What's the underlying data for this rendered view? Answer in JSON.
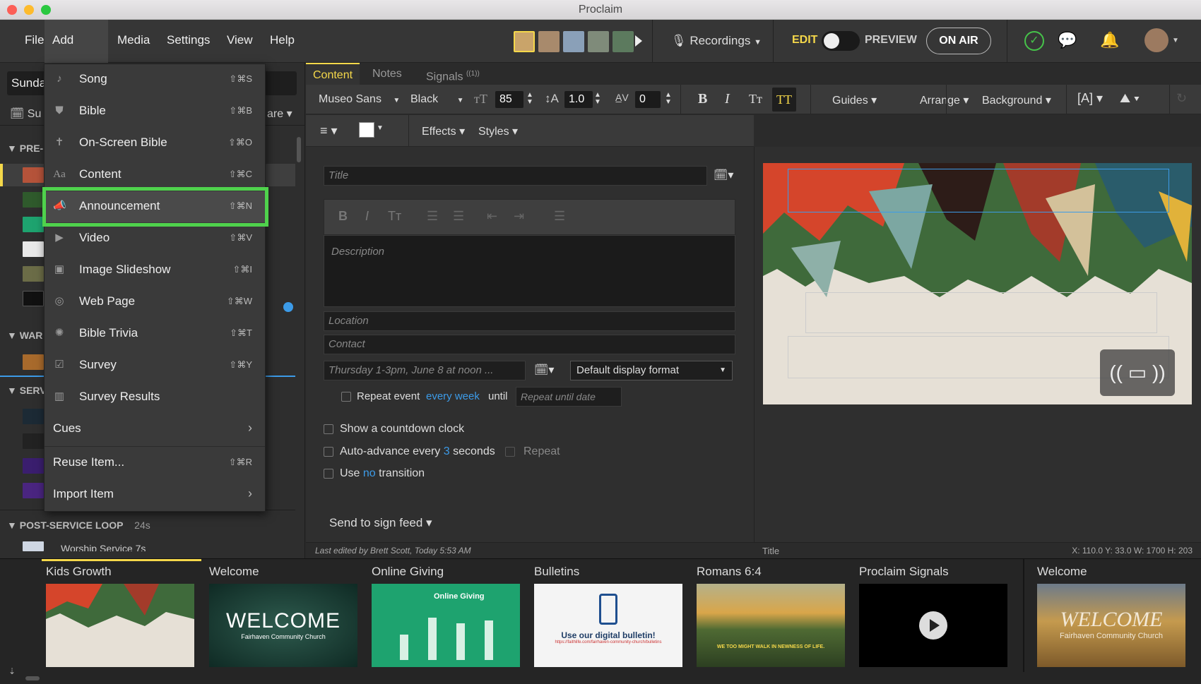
{
  "app": {
    "title": "Proclaim"
  },
  "menubar": {
    "items": [
      "File",
      "Add Item",
      "Media",
      "Settings",
      "View",
      "Help"
    ],
    "recordings": "Recordings",
    "edit": "EDIT",
    "preview": "PREVIEW",
    "on_air": "ON AIR"
  },
  "left": {
    "service_name": "Sunda",
    "date_label": "Su",
    "share_label": "are",
    "sections": [
      {
        "label": "PRE-"
      },
      {
        "label": "WAR"
      },
      {
        "label": "SERV"
      },
      {
        "label": "POST-SERVICE LOOP",
        "duration": "24s"
      }
    ],
    "loop_item": "Worship Service",
    "loop_item_dur": "7s"
  },
  "dropdown": {
    "items": [
      {
        "label": "Song",
        "shortcut": "⇧⌘S",
        "icon": "music-note-icon"
      },
      {
        "label": "Bible",
        "shortcut": "⇧⌘B",
        "icon": "bible-icon"
      },
      {
        "label": "On-Screen Bible",
        "shortcut": "⇧⌘O",
        "icon": "cross-icon"
      },
      {
        "label": "Content",
        "shortcut": "⇧⌘C",
        "icon": "text-aa-icon"
      },
      {
        "label": "Announcement",
        "shortcut": "⇧⌘N",
        "icon": "megaphone-icon"
      },
      {
        "label": "Video",
        "shortcut": "⇧⌘V",
        "icon": "play-circle-icon"
      },
      {
        "label": "Image Slideshow",
        "shortcut": "⇧⌘I",
        "icon": "images-icon"
      },
      {
        "label": "Web Page",
        "shortcut": "⇧⌘W",
        "icon": "globe-icon"
      },
      {
        "label": "Bible Trivia",
        "shortcut": "⇧⌘T",
        "icon": "trivia-wheel-icon"
      },
      {
        "label": "Survey",
        "shortcut": "⇧⌘Y",
        "icon": "survey-check-icon"
      },
      {
        "label": "Survey Results",
        "shortcut": "",
        "icon": "bar-chart-icon"
      }
    ],
    "cues": "Cues",
    "reuse": "Reuse Item...",
    "reuse_shortcut": "⇧⌘R",
    "import": "Import Item"
  },
  "tabs": [
    "Content",
    "Notes",
    "Signals"
  ],
  "signals_badge": "((1))",
  "toolbar": {
    "font": "Museo Sans",
    "weight": "Black",
    "size": "85",
    "line_height": "1.0",
    "tracking": "0",
    "guides": "Guides",
    "arrange": "Arrange",
    "background": "Background",
    "effects": "Effects",
    "styles": "Styles"
  },
  "form": {
    "title_ph": "Title",
    "desc_ph": "Description",
    "location_ph": "Location",
    "contact_ph": "Contact",
    "date_ph": "Thursday 1-3pm, June 8 at noon ...",
    "display_format": "Default display format",
    "repeat_label": "Repeat event",
    "repeat_freq": "every week",
    "until": "until",
    "repeat_until_ph": "Repeat until date",
    "countdown": "Show a countdown clock",
    "autoadv_pre": "Auto-advance every",
    "autoadv_n": "3",
    "autoadv_post": "seconds",
    "repeat": "Repeat",
    "use": "Use",
    "no": "no",
    "transition": "transition",
    "send": "Send to sign feed"
  },
  "status": {
    "last_edited": "Last edited by Brett Scott, Today 5:53 AM",
    "selected": "Title",
    "coords": "X: 110.0  Y: 33.0   W: 1700  H: 203"
  },
  "strip": {
    "slides": [
      {
        "title": "Kids Growth"
      },
      {
        "title": "Welcome",
        "img_big": "WELCOME",
        "img_small": "Fairhaven Community Church"
      },
      {
        "title": "Online Giving",
        "img_big": "Online Giving"
      },
      {
        "title": "Bulletins",
        "img_big": "Use our digital bulletin!",
        "img_small": "https://faithlife.com/fairhaven-community-church/bulletins"
      },
      {
        "title": "Romans 6:4",
        "img_big": "WE TOO MIGHT WALK IN NEWNESS OF LIFE."
      },
      {
        "title": "Proclaim Signals"
      },
      {
        "title": "Welcome",
        "img_big": "WELCOME",
        "img_small": "Fairhaven Community Church"
      }
    ]
  },
  "colors": {
    "accent_yellow": "#f5d84a",
    "highlight_green": "#4fd24c",
    "link_blue": "#3c9be8"
  }
}
